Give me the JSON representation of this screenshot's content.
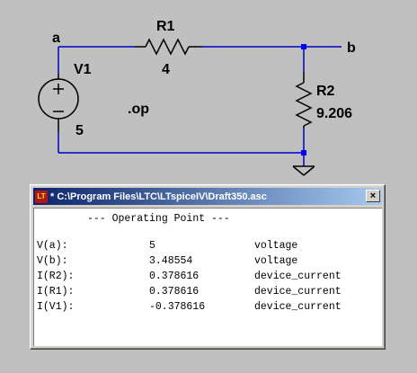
{
  "schematic": {
    "nodes": {
      "a": "a",
      "b": "b"
    },
    "components": {
      "r1": {
        "name": "R1",
        "value": "4"
      },
      "r2": {
        "name": "R2",
        "value": "9.206"
      },
      "v1": {
        "name": "V1",
        "value": "5"
      }
    },
    "directive": ".op",
    "colors": {
      "wire": "#0000c0",
      "node": "#0000ff",
      "component": "#000000",
      "background": "#c0c0c0"
    }
  },
  "window": {
    "title": "* C:\\Program Files\\LTC\\LTspiceIV\\Draft350.asc",
    "close_label": "×",
    "icon": "ltspice-app-icon",
    "header": "--- Operating Point ---",
    "rows": [
      {
        "name": "V(a):",
        "value": "5",
        "type": "voltage"
      },
      {
        "name": "V(b):",
        "value": "3.48554",
        "type": "voltage"
      },
      {
        "name": "I(R2):",
        "value": "0.378616",
        "type": "device_current"
      },
      {
        "name": "I(R1):",
        "value": "0.378616",
        "type": "device_current"
      },
      {
        "name": "I(V1):",
        "value": "-0.378616",
        "type": "device_current"
      }
    ]
  }
}
